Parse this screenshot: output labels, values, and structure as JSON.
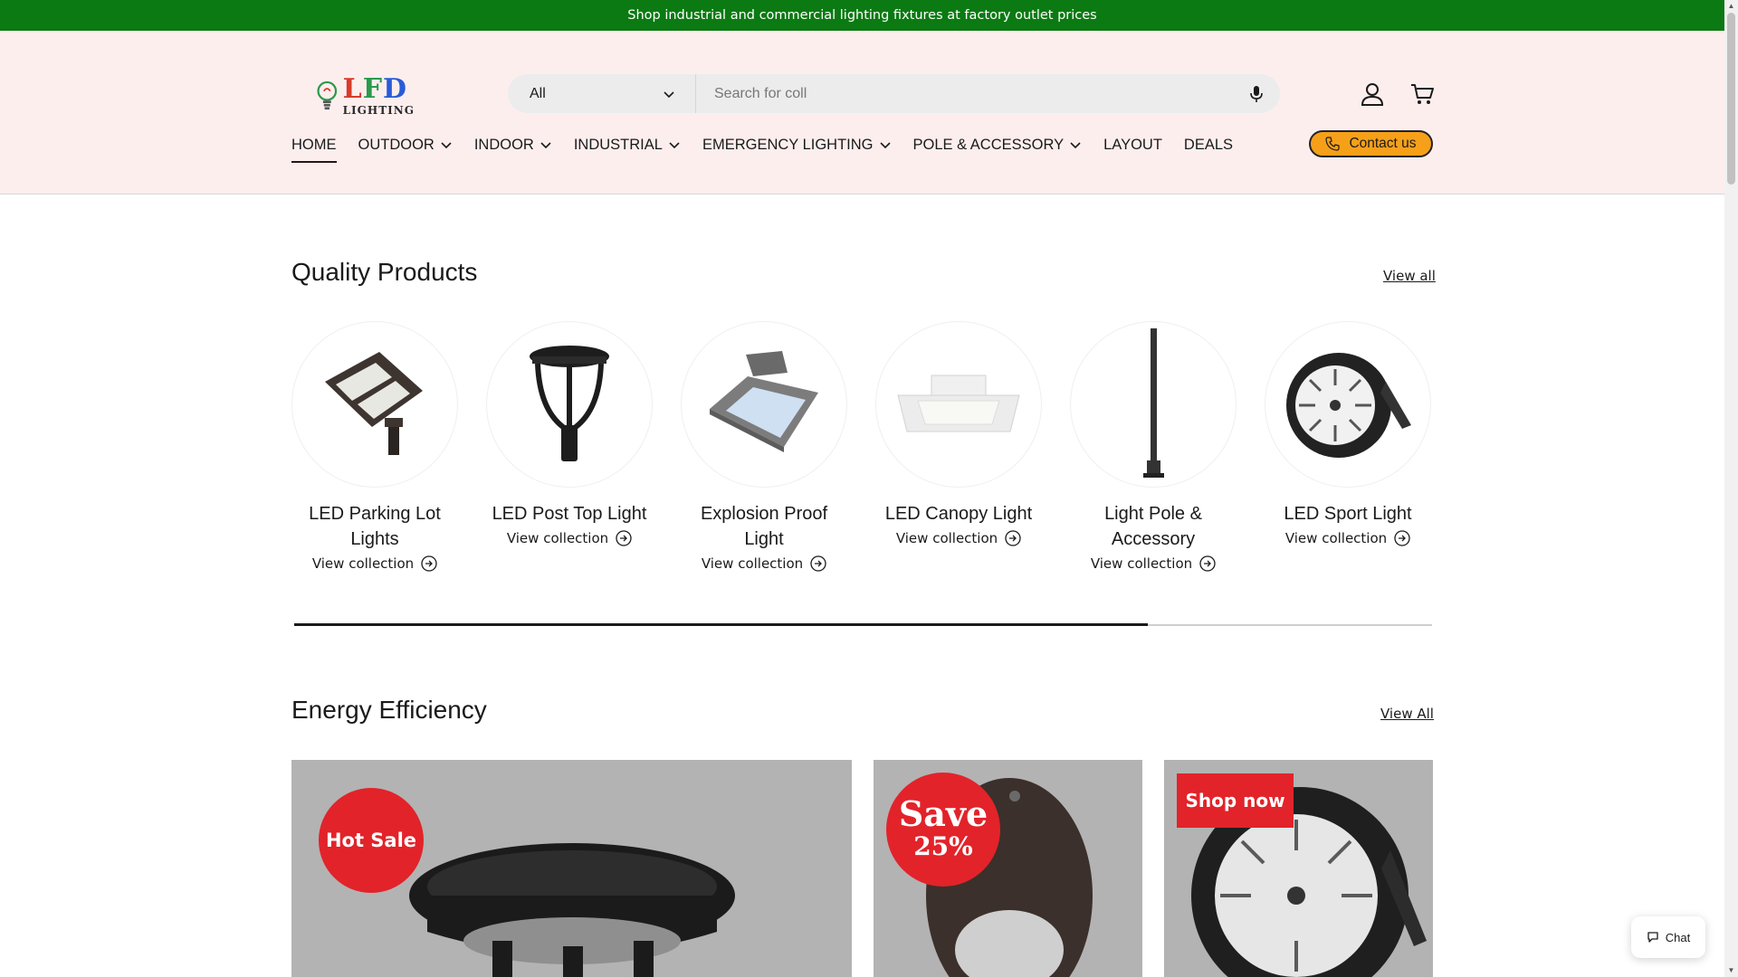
{
  "announcement": "Shop industrial and commercial lighting fixtures at factory outlet prices",
  "logo": {
    "text_l": "L",
    "text_f": "F",
    "text_d": "D",
    "sub": "LIGHTING"
  },
  "search": {
    "category": "All",
    "placeholder": "Search for coll",
    "value": ""
  },
  "nav": {
    "items": [
      {
        "label": "HOME"
      },
      {
        "label": "OUTDOOR"
      },
      {
        "label": "INDOOR"
      },
      {
        "label": "INDUSTRIAL"
      },
      {
        "label": "EMERGENCY LIGHTING"
      },
      {
        "label": "POLE & ACCESSORY"
      },
      {
        "label": "LAYOUT"
      },
      {
        "label": "DEALS"
      }
    ],
    "active": "HOME",
    "contact_label": "Contact us"
  },
  "quality": {
    "title": "Quality Products",
    "view_all": "View all",
    "link_label": "View collection",
    "scroll_progress": 0.75,
    "collections": [
      {
        "title": "LED Parking Lot Lights",
        "icon": "parking-lot-light"
      },
      {
        "title": "LED Post Top Light",
        "icon": "post-top-light"
      },
      {
        "title": "Explosion Proof Light",
        "icon": "explosion-proof-light"
      },
      {
        "title": "LED Canopy Light",
        "icon": "canopy-light"
      },
      {
        "title": "Light Pole & Accessory",
        "icon": "light-pole"
      },
      {
        "title": "LED Sport Light",
        "icon": "sport-light"
      }
    ]
  },
  "energy": {
    "title": "Energy Efficiency",
    "view_all": "View All",
    "cards": [
      {
        "badge": "Hot Sale"
      },
      {
        "badge_line1": "Save",
        "badge_line2": "25%"
      },
      {
        "badge": "Shop now"
      }
    ]
  },
  "chat_label": "Chat",
  "colors": {
    "announcement_bg": "#0b7a12",
    "header_bg": "#fdeeee",
    "contact_bg": "#f6a01a",
    "badge_red": "#e2232a"
  }
}
